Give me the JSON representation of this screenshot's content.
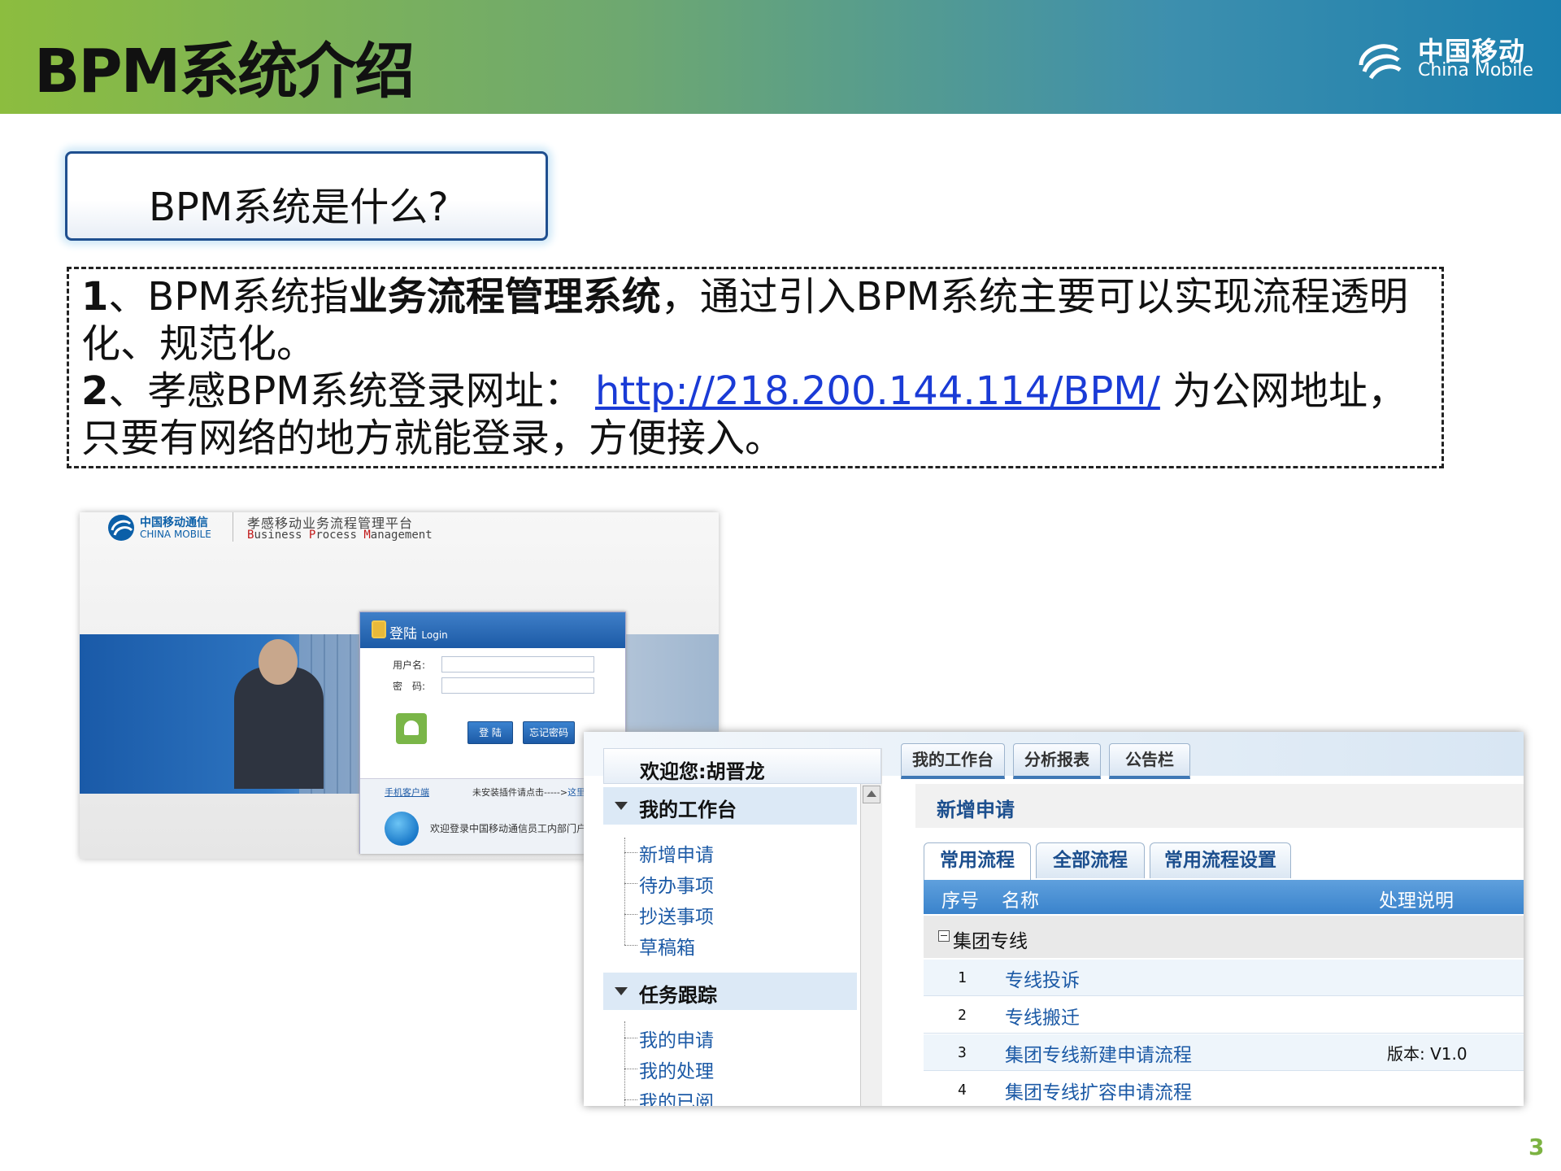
{
  "header": {
    "title": "BPM系统介绍",
    "logo_cn": "中国移动",
    "logo_en": "China Mobile"
  },
  "question": "BPM系统是什么?",
  "point1": {
    "num": "1",
    "pre": "、BPM系统指",
    "bold": "业务流程管理系统",
    "post": "，通过引入BPM系统主要可以实现流程透明化、规范化。"
  },
  "point2": {
    "num": "2",
    "pre": "、孝感BPM系统登录网址：",
    "url": "http://218.200.144.114/BPM/",
    "post": " 为公网地址，只要有网络的地方就能登录，方便接入。"
  },
  "login": {
    "logo_cn": "中国移动通信",
    "logo_en": "CHINA MOBILE",
    "platform": "孝感移动业务流程管理平台",
    "bpm_b": "B",
    "bpm_usiness": "usiness ",
    "bpm_p": "P",
    "bpm_rocess": "rocess ",
    "bpm_m": "M",
    "bpm_anagement": "anagement",
    "panel_title": "登陆",
    "panel_title_en": "Login",
    "username_label": "用户名:",
    "password_label": "密　码:",
    "login_button": "登 陆",
    "forgot_button": "忘记密码",
    "mobile_client": "手机客户端",
    "plugin_text": "未安装插件请点击----->",
    "plugin_link": "这里",
    "welcome": "欢迎登录中国移动通信员工内部门户"
  },
  "workbench": {
    "welcome": "欢迎您:胡晋龙",
    "sections": [
      {
        "title": "我的工作台",
        "items": [
          "新增申请",
          "待办事项",
          "抄送事项",
          "草稿箱"
        ]
      },
      {
        "title": "任务跟踪",
        "items": [
          "我的申请",
          "我的处理",
          "我的已阅"
        ]
      }
    ],
    "top_tabs": [
      "我的工作台",
      "分析报表",
      "公告栏"
    ],
    "page_title": "新增申请",
    "tabs": [
      "常用流程",
      "全部流程",
      "常用流程设置"
    ],
    "columns": {
      "seq": "序号",
      "name": "名称",
      "desc": "处理说明"
    },
    "group": "集团专线",
    "rows": [
      {
        "num": "1",
        "name": "专线投诉",
        "note": ""
      },
      {
        "num": "2",
        "name": "专线搬迁",
        "note": ""
      },
      {
        "num": "3",
        "name": "集团专线新建申请流程",
        "note": "版本: V1.0"
      },
      {
        "num": "4",
        "name": "集团专线扩容申请流程",
        "note": ""
      }
    ]
  },
  "page_number": "3"
}
